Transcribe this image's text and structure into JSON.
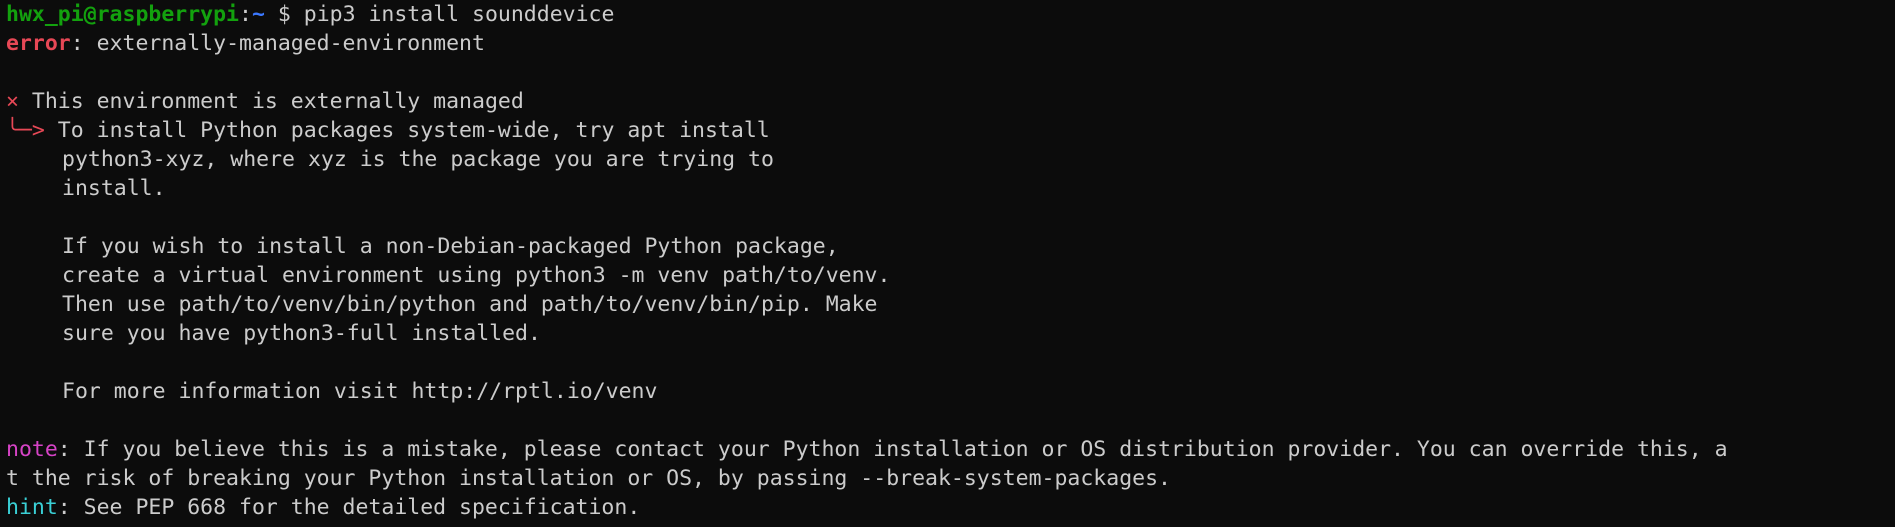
{
  "prompt": {
    "user_host": "hwx_pi@raspberrypi",
    "colon": ":",
    "path": "~",
    "dollar": "$",
    "command": " pip3 install sounddevice"
  },
  "error": {
    "label": "error",
    "message": ": externally-managed-environment"
  },
  "managed": {
    "x_mark": "×",
    "title": " This environment is externally managed",
    "arrow": "╰─>",
    "lines": [
      " To install Python packages system-wide, try apt install",
      "python3-xyz, where xyz is the package you are trying to",
      "install.",
      "",
      "If you wish to install a non-Debian-packaged Python package,",
      "create a virtual environment using python3 -m venv path/to/venv.",
      "Then use path/to/venv/bin/python and path/to/venv/bin/pip. Make",
      "sure you have python3-full installed.",
      "",
      "For more information visit http://rptl.io/venv"
    ]
  },
  "note": {
    "label": "note",
    "line1": ": If you believe this is a mistake, please contact your Python installation or OS distribution provider. You can override this, a",
    "line2": "t the risk of breaking your Python installation or OS, by passing --break-system-packages."
  },
  "hint": {
    "label": "hint",
    "message": ": See PEP 668 for the detailed specification."
  },
  "colors": {
    "background": "#0c0c0c",
    "foreground": "#cccccc",
    "prompt_user": "#13a10e",
    "prompt_path": "#3b78ff",
    "error": "#e74856",
    "note": "#d643c6",
    "hint": "#3ad0d6"
  }
}
